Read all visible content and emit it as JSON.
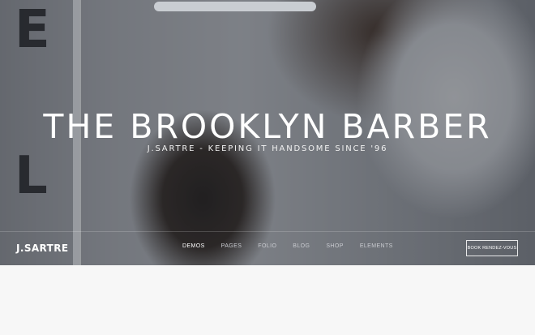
{
  "hero": {
    "wall_letters": [
      "E",
      "L"
    ],
    "headline": "THE BROOKLYN BARBER",
    "subheadline": "J.SARTRE - KEEPING IT HANDSOME SINCE '96"
  },
  "nav": {
    "brand": "J.SARTRE",
    "items": [
      {
        "label": "DEMOS",
        "active": true
      },
      {
        "label": "PAGES",
        "active": false
      },
      {
        "label": "FOLIO",
        "active": false
      },
      {
        "label": "BLOG",
        "active": false
      },
      {
        "label": "SHOP",
        "active": false
      },
      {
        "label": "ELEMENTS",
        "active": false
      }
    ],
    "cta_label": "BOOK RENDEZ-VOUS"
  },
  "colors": {
    "overlay": "#16181e",
    "text": "#ffffff",
    "menu_inactive": "#c9cbd0",
    "page_background": "#f7f7f7"
  }
}
